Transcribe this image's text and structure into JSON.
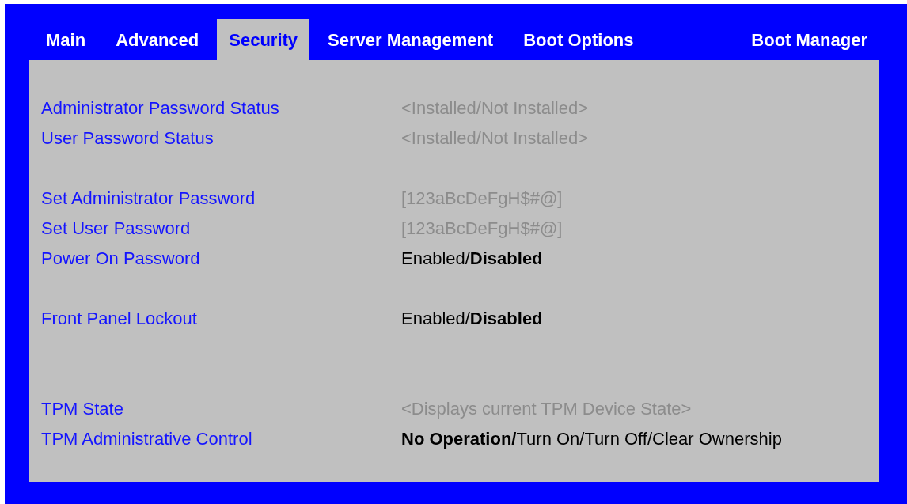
{
  "tabs": [
    {
      "label": "Main",
      "selected": false
    },
    {
      "label": "Advanced",
      "selected": false
    },
    {
      "label": "Security",
      "selected": true
    },
    {
      "label": "Server Management",
      "selected": false
    },
    {
      "label": "Boot Options",
      "selected": false
    },
    {
      "label": "Boot Manager",
      "selected": false
    }
  ],
  "groups": [
    {
      "settings": [
        {
          "label": "Administrator Password Status",
          "kind": "info",
          "value": "<Installed/Not Installed>"
        },
        {
          "label": "User Password Status",
          "kind": "info",
          "value": "<Installed/Not Installed>"
        }
      ]
    },
    {
      "settings": [
        {
          "label": "Set Administrator Password",
          "kind": "info",
          "value": "[123aBcDeFgH$#@]"
        },
        {
          "label": "Set User Password",
          "kind": "info",
          "value": "[123aBcDeFgH$#@]"
        },
        {
          "label": "Power On Password",
          "kind": "options",
          "options": [
            {
              "label": "Enabled/",
              "selected": false
            },
            {
              "label": "Disabled",
              "selected": true
            }
          ]
        }
      ]
    },
    {
      "settings": [
        {
          "label": "Front Panel Lockout",
          "kind": "options",
          "options": [
            {
              "label": "Enabled/",
              "selected": false
            },
            {
              "label": "Disabled",
              "selected": true
            }
          ]
        }
      ]
    },
    {
      "settings": [
        {
          "label": "TPM State",
          "kind": "info",
          "value": "<Displays current TPM Device State>"
        },
        {
          "label": "TPM Administrative Control",
          "kind": "options",
          "options": [
            {
              "label": "No Operation/",
              "selected": true
            },
            {
              "label": "Turn On/",
              "selected": false
            },
            {
              "label": "Turn Off/",
              "selected": false
            },
            {
              "label": "Clear Ownership",
              "selected": false
            }
          ]
        }
      ]
    }
  ]
}
